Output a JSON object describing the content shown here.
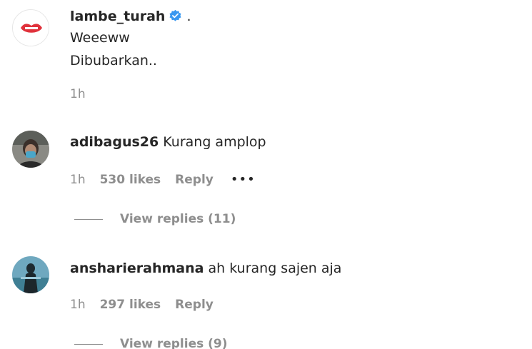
{
  "post": {
    "username": "lambe_turah",
    "verified_icon": "verified-badge-icon",
    "trailing": ".",
    "caption_lines": [
      "Weeeww",
      "Dibubarkan.."
    ],
    "time": "1h"
  },
  "comments": [
    {
      "username": "adibagus26",
      "text": "Kurang amplop",
      "time": "1h",
      "likes": "530 likes",
      "reply_label": "Reply",
      "more_label": "•••",
      "view_replies": "View replies (11)"
    },
    {
      "username": "ansharierahmana",
      "text": "ah kurang sajen aja",
      "time": "1h",
      "likes": "297 likes",
      "reply_label": "Reply",
      "view_replies": "View replies (9)"
    }
  ],
  "colors": {
    "text": "#262626",
    "secondary": "#8e8e8e",
    "verified": "#3897f0",
    "brand_red": "#e0323c"
  }
}
